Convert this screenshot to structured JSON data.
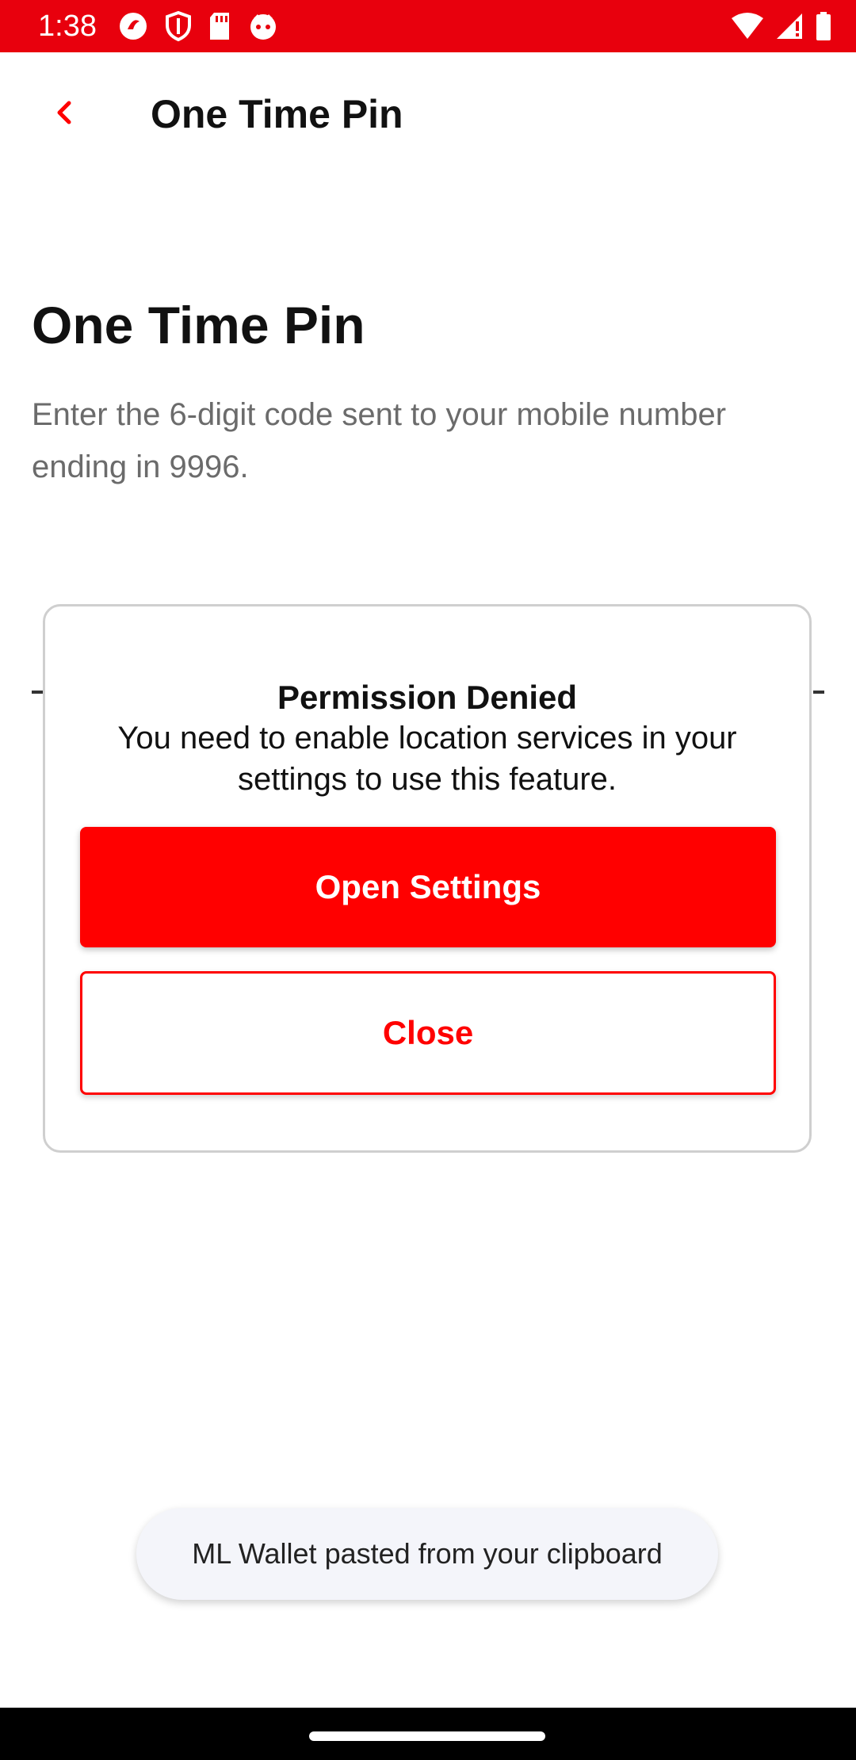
{
  "status_bar": {
    "time": "1:38",
    "left_icons": [
      "app-notification-icon",
      "shield-icon",
      "sd-card-icon",
      "app-face-icon"
    ],
    "right_icons": [
      "wifi-icon",
      "signal-icon",
      "battery-icon"
    ],
    "background_color": "#e8000d"
  },
  "app_bar": {
    "title": "One Time Pin",
    "back_icon": "chevron-left-icon"
  },
  "main": {
    "heading": "One Time Pin",
    "description": "Enter the 6-digit code sent to your mobile number ending in 9996."
  },
  "dialog": {
    "title": "Permission Denied",
    "message": "You need to enable location services in your settings to use this feature.",
    "primary_button_label": "Open Settings",
    "secondary_button_label": "Close"
  },
  "toast": {
    "text": "ML Wallet pasted from your clipboard"
  },
  "colors": {
    "accent_red": "#ff0000",
    "status_bar_red": "#e8000d",
    "description_gray": "#6b6b6b"
  }
}
